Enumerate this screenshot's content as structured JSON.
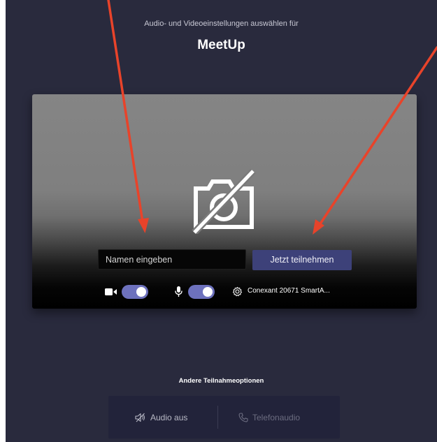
{
  "header": {
    "subtitle": "Audio- und Videoeinstellungen auswählen für",
    "meeting_title": "MeetUp"
  },
  "preview": {
    "camera_off_icon": "camera-off-icon",
    "name_input": {
      "value": "",
      "placeholder": "Namen eingeben"
    },
    "join_button_label": "Jetzt teilnehmen"
  },
  "controls": {
    "video_toggle": {
      "icon": "video-camera-icon",
      "on": true
    },
    "mic_toggle": {
      "icon": "microphone-icon",
      "on": true
    },
    "device": {
      "icon": "gear-icon",
      "label": "Conexant 20671 SmartA..."
    }
  },
  "other_options": {
    "title": "Andere Teilnahmeoptionen",
    "audio_off": {
      "icon": "speaker-off-icon",
      "label": "Audio aus"
    },
    "phone_audio": {
      "icon": "phone-icon",
      "label": "Telefonaudio"
    }
  },
  "colors": {
    "background": "#292a3d",
    "accent": "#3d4179",
    "toggle": "#6d71bd",
    "annotation_arrow": "#e8432a"
  }
}
